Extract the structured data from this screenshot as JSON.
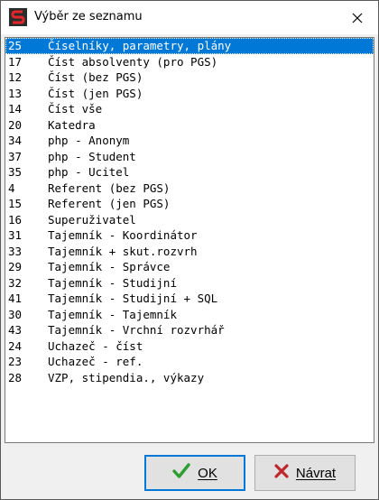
{
  "window": {
    "title": "Výběr ze seznamu",
    "app_icon": "app-logo-icon",
    "close_icon": "close-icon"
  },
  "list": {
    "selected_index": 0,
    "items": [
      {
        "code": "25",
        "name": "Číselníky, parametry, plány"
      },
      {
        "code": "17",
        "name": "Číst absolventy (pro PGS)"
      },
      {
        "code": "12",
        "name": "Číst (bez PGS)"
      },
      {
        "code": "13",
        "name": "Číst (jen PGS)"
      },
      {
        "code": "14",
        "name": "Číst vše"
      },
      {
        "code": "20",
        "name": "Katedra"
      },
      {
        "code": "34",
        "name": "php - Anonym"
      },
      {
        "code": "37",
        "name": "php - Student"
      },
      {
        "code": "35",
        "name": "php - Ucitel"
      },
      {
        "code": "4",
        "name": "Referent (bez PGS)"
      },
      {
        "code": "15",
        "name": "Referent (jen PGS)"
      },
      {
        "code": "16",
        "name": "Superuživatel"
      },
      {
        "code": "31",
        "name": "Tajemník - Koordinátor"
      },
      {
        "code": "33",
        "name": "Tajemník + skut.rozvrh"
      },
      {
        "code": "29",
        "name": "Tajemník - Správce"
      },
      {
        "code": "32",
        "name": "Tajemník - Studijní"
      },
      {
        "code": "41",
        "name": "Tajemník - Studijní + SQL"
      },
      {
        "code": "30",
        "name": "Tajemník - Tajemník"
      },
      {
        "code": "43",
        "name": "Tajemník - Vrchní rozvrhář"
      },
      {
        "code": "24",
        "name": "Uchazeč - číst"
      },
      {
        "code": "23",
        "name": "Uchazeč - ref."
      },
      {
        "code": "28",
        "name": "VZP, stipendia., výkazy"
      }
    ]
  },
  "buttons": {
    "ok_label": "OK",
    "ok_icon": "checkmark-icon",
    "cancel_label": "Návrat",
    "cancel_icon": "x-mark-icon"
  },
  "colors": {
    "selection": "#0078d7",
    "ok_check": "#2e9e2e",
    "cancel_x": "#c0272d"
  }
}
